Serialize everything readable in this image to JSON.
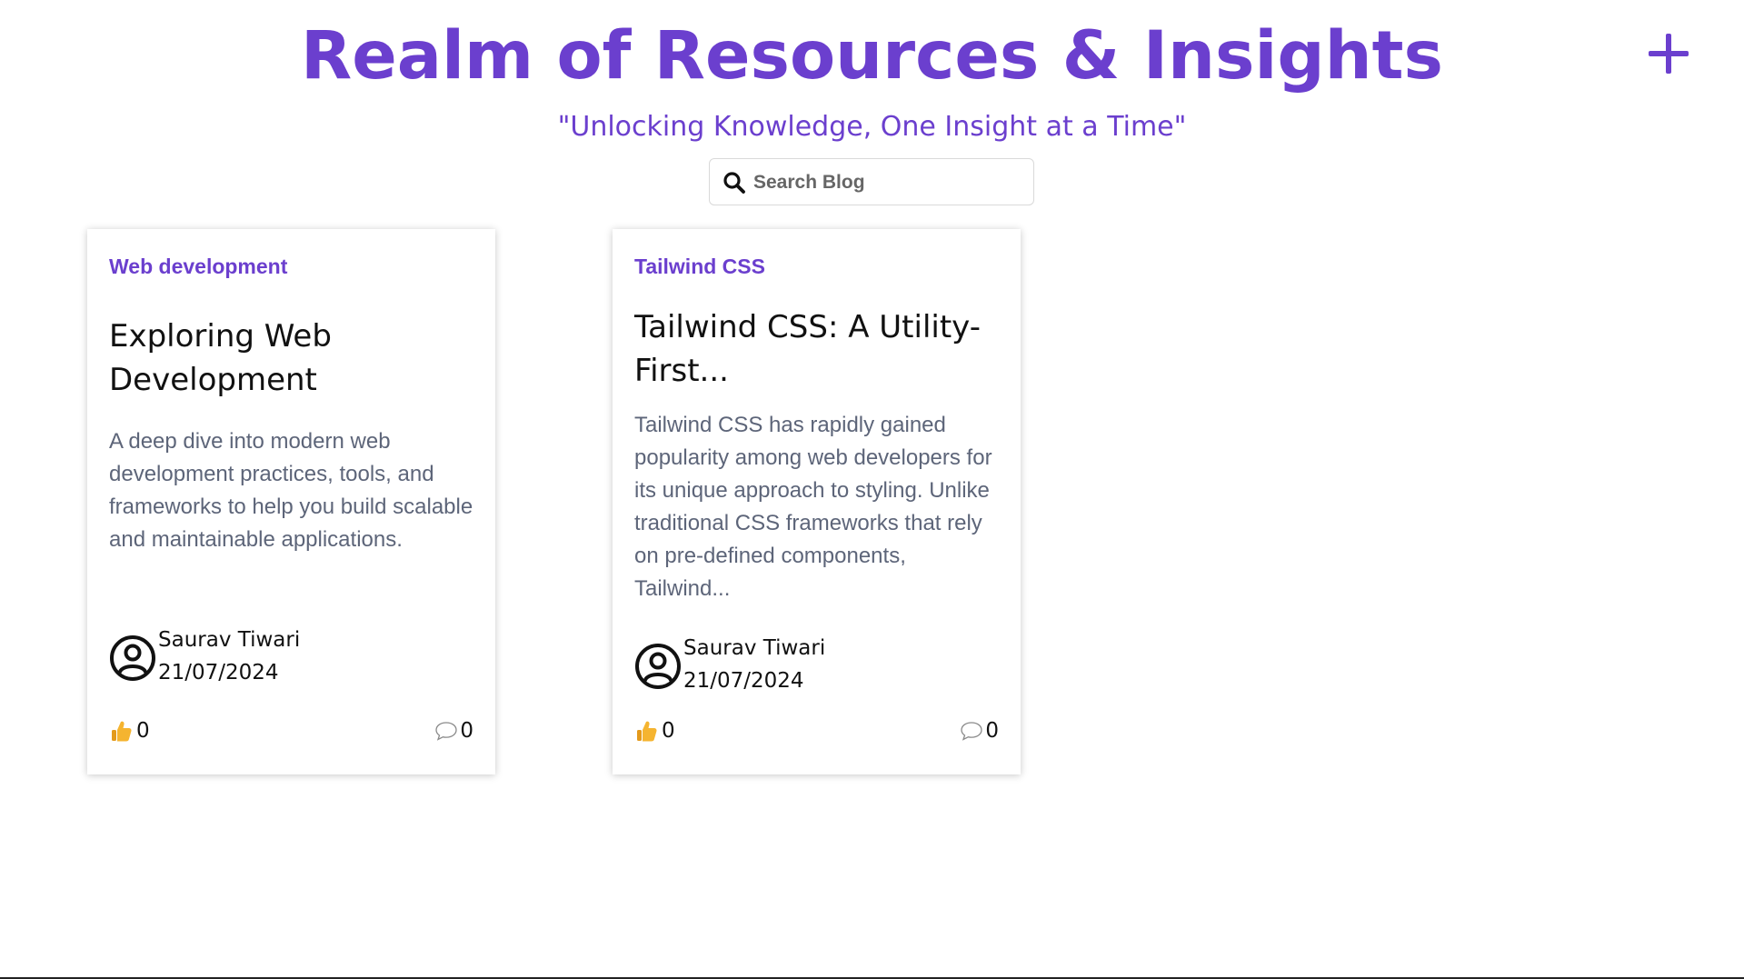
{
  "header": {
    "title": "Realm of Resources & Insights",
    "tagline": "\"Unlocking Knowledge, One Insight at a Time\"",
    "add_icon": "plus-icon"
  },
  "search": {
    "placeholder": "Search Blog",
    "value": "",
    "icon": "search-icon"
  },
  "posts": [
    {
      "category": "Web development",
      "title": "Exploring Web Development",
      "description": "A deep dive into modern web development practices, tools, and frameworks to help you build scalable and maintainable applications.",
      "author": "Saurav Tiwari",
      "date": "21/07/2024",
      "likes": "0",
      "comments": "0"
    },
    {
      "category": "Tailwind CSS",
      "title": "Tailwind CSS: A Utility-First...",
      "description": "Tailwind CSS has rapidly gained popularity among web developers for its unique approach to styling. Unlike traditional CSS frameworks that rely on pre-defined components, Tailwind...",
      "author": "Saurav Tiwari",
      "date": "21/07/2024",
      "likes": "0",
      "comments": "0"
    }
  ],
  "colors": {
    "accent": "#6b3fce",
    "description_text": "#5d6579",
    "like_icon": "#f5b430"
  },
  "icons": {
    "avatar": "user-circle-icon",
    "like": "thumbs-up-icon",
    "comment": "speech-bubble-icon"
  }
}
